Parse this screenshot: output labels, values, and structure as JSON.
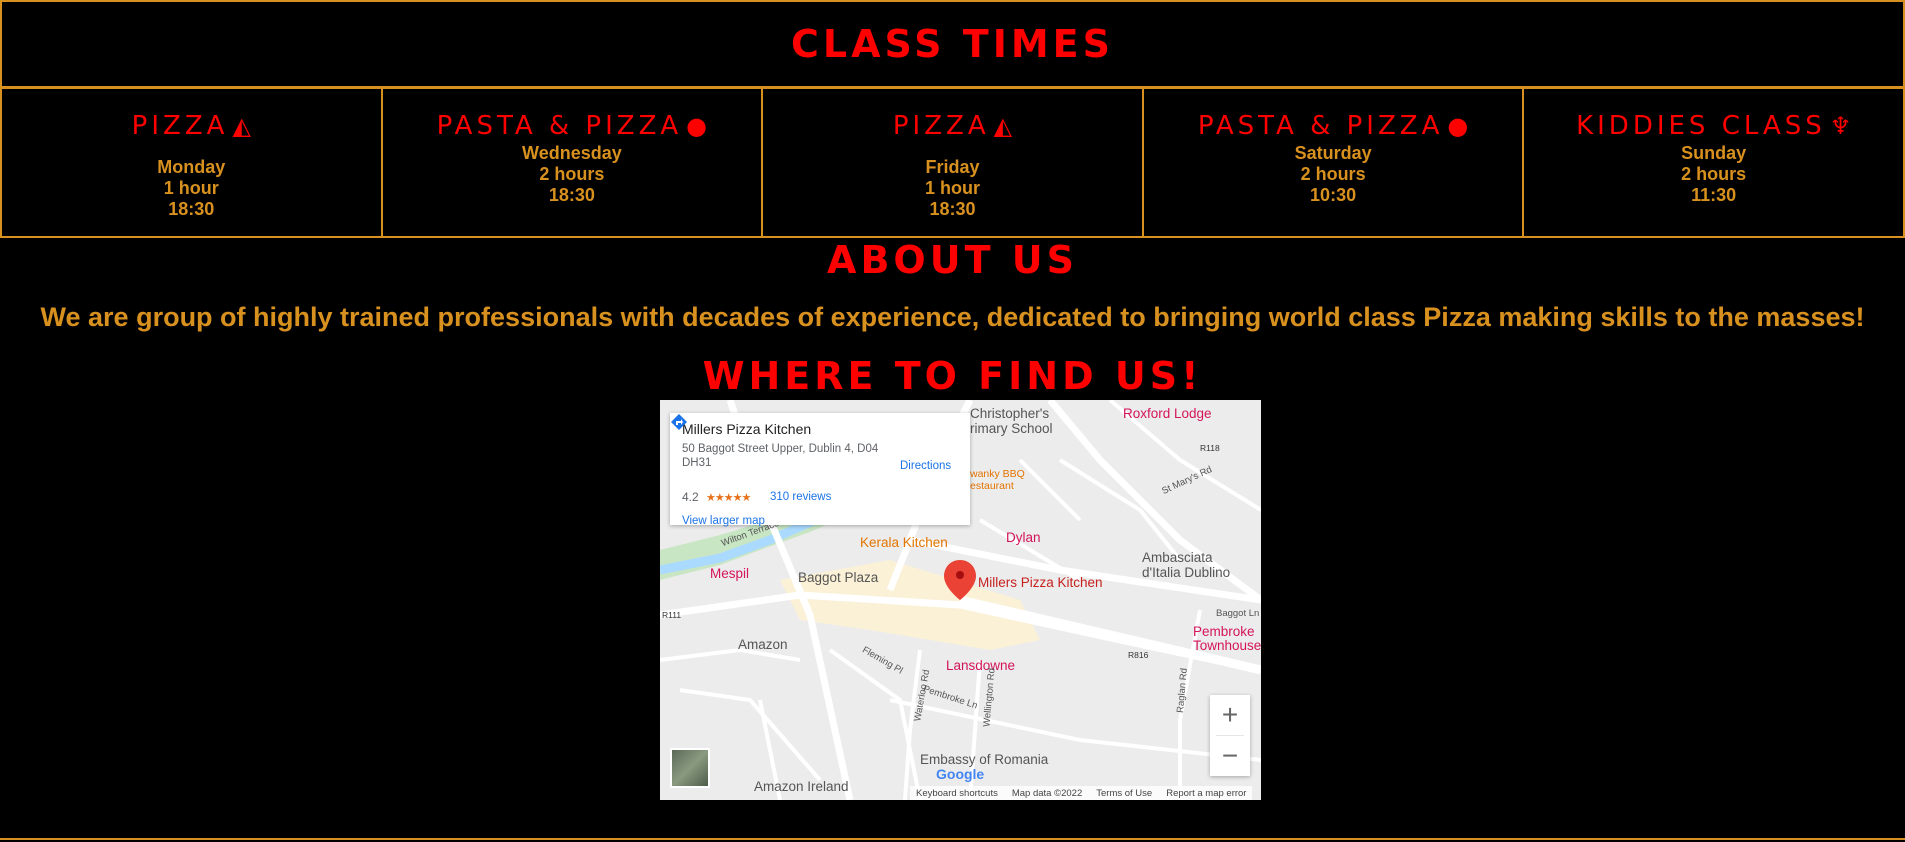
{
  "headings": {
    "class_times": "CLASS TIMES",
    "about_us": "ABOUT US",
    "where": "WHERE TO FIND US!"
  },
  "classes": [
    {
      "title": "PIZZA",
      "icon": "pizza-slice-icon",
      "glyph": "◭",
      "day": "Monday",
      "duration": "1 hour",
      "time": "18:30"
    },
    {
      "title": "PASTA & PIZZA",
      "icon": "egg-icon",
      "glyph": "●",
      "day": "Wednesday",
      "duration": "2 hours",
      "time": "18:30"
    },
    {
      "title": "PIZZA",
      "icon": "pizza-slice-icon",
      "glyph": "◭",
      "day": "Friday",
      "duration": "1 hour",
      "time": "18:30"
    },
    {
      "title": "PASTA & PIZZA",
      "icon": "egg-icon",
      "glyph": "●",
      "day": "Saturday",
      "duration": "2 hours",
      "time": "10:30"
    },
    {
      "title": "KIDDIES CLASS",
      "icon": "child-icon",
      "glyph": "♆",
      "day": "Sunday",
      "duration": "2 hours",
      "time": "11:30"
    }
  ],
  "about": {
    "text": "We are group of highly trained professionals with decades of experience, dedicated to bringing world class Pizza making skills to the masses!"
  },
  "map": {
    "place_name": "Millers Pizza Kitchen",
    "address": "50 Baggot Street Upper, Dublin 4, D04 DH31",
    "rating": "4.2",
    "stars": "★★★★★",
    "reviews": "310 reviews",
    "directions": "Directions",
    "view_larger": "View larger map",
    "google": "Google",
    "attribution": {
      "shortcuts": "Keyboard shortcuts",
      "data": "Map data ©2022",
      "terms": "Terms of Use",
      "report": "Report a map error"
    },
    "labels": {
      "school_a": "Christopher's",
      "school_b": "rimary School",
      "roxford": "Roxford Lodge",
      "bbq_a": "wanky BBQ",
      "bbq_b": "estaurant",
      "dylan": "Dylan",
      "kerala": "Kerala Kitchen",
      "ambasciata_a": "Ambasciata",
      "ambasciata_b": "d'Italia Dublino",
      "mespil": "Mespil",
      "baggot_plaza": "Baggot Plaza",
      "millers": "Millers Pizza Kitchen",
      "amazon": "Amazon",
      "pembroke_a": "Pembroke",
      "pembroke_b": "Townhouse",
      "lansdowne": "Lansdowne",
      "embassy": "Embassy of Romania",
      "amazon_ireland": "Amazon Ireland",
      "r111": "R111",
      "r118": "R118",
      "r816": "R816",
      "st_marys": "St Mary's Rd",
      "wilton": "Wilton Terrace",
      "fleming": "Fleming Pl",
      "waterloo": "Waterloo Rd",
      "pembroke_ln": "Pembroke Ln",
      "wellington": "Wellington Rd",
      "raglan": "Raglan Rd",
      "baggot_ln": "Baggot Ln"
    },
    "colors": {
      "pin": "#ea4335",
      "road": "#ffffff",
      "water": "#aadaff",
      "park": "#c8e6c4",
      "highlight": "#fbf1d6"
    }
  },
  "colors": {
    "heading": "#ff0000",
    "accent": "#d8911e",
    "background": "#000000"
  }
}
